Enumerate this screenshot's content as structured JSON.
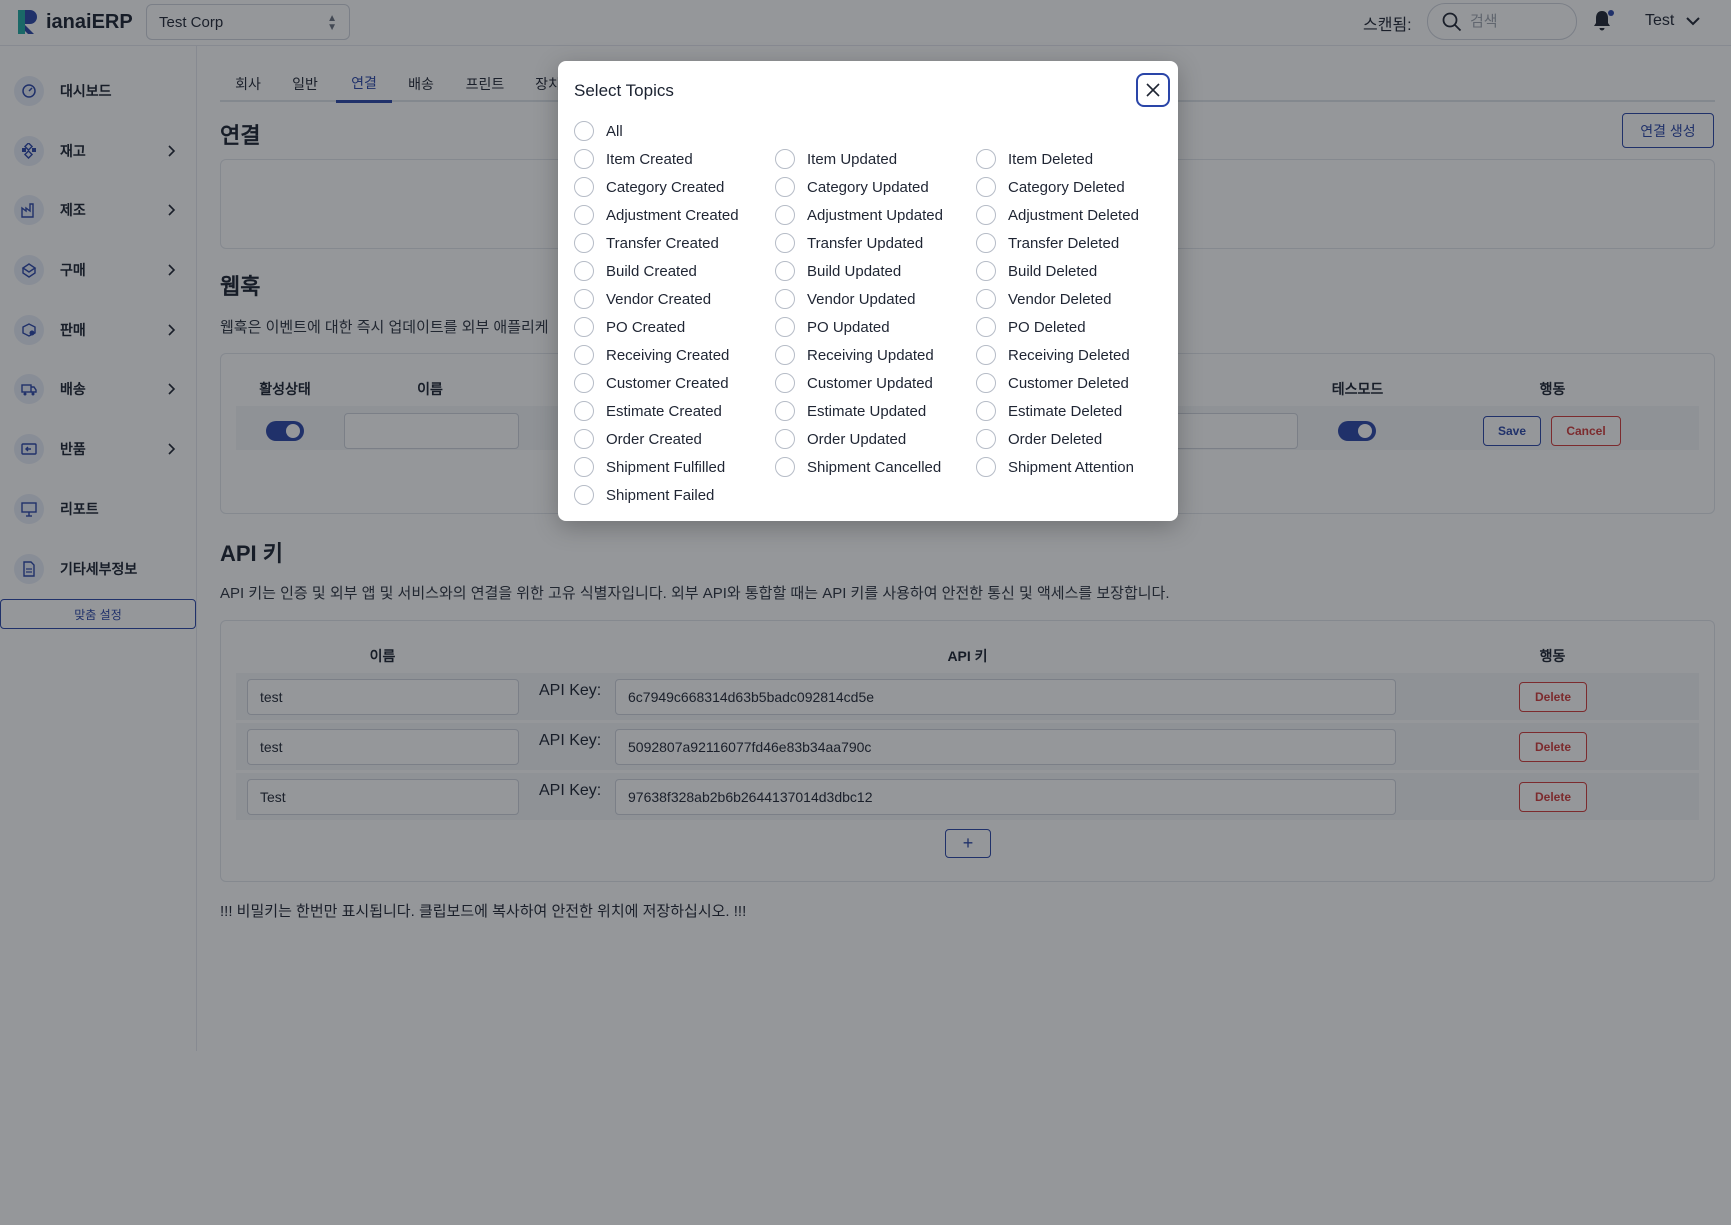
{
  "header": {
    "brand": "ianaiERP",
    "company": "Test Corp",
    "scan_label": "스캔됨:",
    "search_placeholder": "검색",
    "user": "Test"
  },
  "sidebar": {
    "items": [
      {
        "label": "대시보드",
        "icon": "gauge-icon",
        "has_children": false
      },
      {
        "label": "재고",
        "icon": "inventory-icon",
        "has_children": true
      },
      {
        "label": "제조",
        "icon": "factory-icon",
        "has_children": true
      },
      {
        "label": "구매",
        "icon": "purchase-icon",
        "has_children": true
      },
      {
        "label": "판매",
        "icon": "sales-icon",
        "has_children": true
      },
      {
        "label": "배송",
        "icon": "truck-icon",
        "has_children": true
      },
      {
        "label": "반품",
        "icon": "return-icon",
        "has_children": true
      },
      {
        "label": "리포트",
        "icon": "report-icon",
        "has_children": false
      },
      {
        "label": "기타세부정보",
        "icon": "document-icon",
        "has_children": false
      }
    ],
    "custom_settings": "맞춤 설정"
  },
  "tabs": [
    {
      "label": "회사",
      "active": false
    },
    {
      "label": "일반",
      "active": false
    },
    {
      "label": "연결",
      "active": true
    },
    {
      "label": "배송",
      "active": false
    },
    {
      "label": "프린트",
      "active": false
    },
    {
      "label": "장치",
      "active": false
    }
  ],
  "connections": {
    "title": "연결",
    "create_button": "연결 생성"
  },
  "webhooks": {
    "title": "웹훅",
    "description": "웹훅은 이벤트에 대한 즉시 업데이트를 외부 애플리케",
    "columns": {
      "active": "활성상태",
      "name": "이름",
      "test_mode": "테스모드",
      "action": "행동"
    },
    "row": {
      "active": true,
      "name": "",
      "test_mode": true,
      "save": "Save",
      "cancel": "Cancel"
    }
  },
  "api_keys": {
    "title": "API 키",
    "description": "API 키는 인증 및 외부 앱 및 서비스와의 연결을 위한 고유 식별자입니다. 외부 API와 통합할 때는 API 키를 사용하여 안전한 통신 및 액세스를 보장합니다.",
    "columns": {
      "name": "이름",
      "key": "API 키",
      "action": "행동"
    },
    "key_label": "API Key:",
    "delete_label": "Delete",
    "add_label": "+",
    "rows": [
      {
        "name": "test",
        "key": "6c7949c668314d63b5badc092814cd5e"
      },
      {
        "name": "test",
        "key": "5092807a92116077fd46e83b34aa790c"
      },
      {
        "name": "Test",
        "key": "97638f328ab2b6b2644137014d3dbc12"
      }
    ]
  },
  "footer_note": "!!! 비밀키는 한번만 표시됩니다. 클립보드에 복사하여 안전한 위치에 저장하십시오. !!!",
  "modal": {
    "title": "Select Topics",
    "all_label": "All",
    "topics": [
      [
        "Item Created",
        "Item Updated",
        "Item Deleted"
      ],
      [
        "Category Created",
        "Category Updated",
        "Category Deleted"
      ],
      [
        "Adjustment Created",
        "Adjustment Updated",
        "Adjustment Deleted"
      ],
      [
        "Transfer Created",
        "Transfer Updated",
        "Transfer Deleted"
      ],
      [
        "Build Created",
        "Build Updated",
        "Build Deleted"
      ],
      [
        "Vendor Created",
        "Vendor Updated",
        "Vendor Deleted"
      ],
      [
        "PO Created",
        "PO Updated",
        "PO Deleted"
      ],
      [
        "Receiving Created",
        "Receiving Updated",
        "Receiving Deleted"
      ],
      [
        "Customer Created",
        "Customer Updated",
        "Customer Deleted"
      ],
      [
        "Estimate Created",
        "Estimate Updated",
        "Estimate Deleted"
      ],
      [
        "Order Created",
        "Order Updated",
        "Order Deleted"
      ],
      [
        "Shipment Fulfilled",
        "Shipment Cancelled",
        "Shipment Attention"
      ],
      [
        "Shipment Failed"
      ]
    ]
  },
  "colors": {
    "accent": "#2a45a8",
    "danger": "#d23b3b"
  }
}
